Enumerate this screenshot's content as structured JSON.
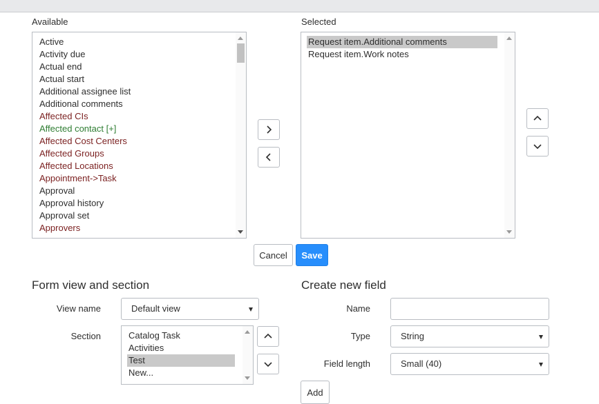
{
  "slushbucket": {
    "available_label": "Available",
    "selected_label": "Selected",
    "available_items": [
      {
        "label": "Active",
        "kind": "normal"
      },
      {
        "label": "Activity due",
        "kind": "normal"
      },
      {
        "label": "Actual end",
        "kind": "normal"
      },
      {
        "label": "Actual start",
        "kind": "normal"
      },
      {
        "label": "Additional assignee list",
        "kind": "normal"
      },
      {
        "label": "Additional comments",
        "kind": "normal"
      },
      {
        "label": "Affected CIs",
        "kind": "reference"
      },
      {
        "label": "Affected contact [+]",
        "kind": "green"
      },
      {
        "label": "Affected Cost Centers",
        "kind": "reference"
      },
      {
        "label": "Affected Groups",
        "kind": "reference"
      },
      {
        "label": "Affected Locations",
        "kind": "reference"
      },
      {
        "label": "Appointment->Task",
        "kind": "reference"
      },
      {
        "label": "Approval",
        "kind": "normal"
      },
      {
        "label": "Approval history",
        "kind": "normal"
      },
      {
        "label": "Approval set",
        "kind": "normal"
      },
      {
        "label": "Approvers",
        "kind": "reference"
      }
    ],
    "selected_items": [
      {
        "label": "Request item.Additional comments",
        "selected": true
      },
      {
        "label": "Request item.Work notes",
        "selected": false
      }
    ]
  },
  "actions": {
    "cancel_label": "Cancel",
    "save_label": "Save"
  },
  "form_view": {
    "heading": "Form view and section",
    "view_name_label": "View name",
    "view_name_value": "Default view",
    "section_label": "Section",
    "sections": [
      {
        "label": "Catalog Task",
        "selected": false
      },
      {
        "label": "Activities",
        "selected": false
      },
      {
        "label": "Test",
        "selected": true
      },
      {
        "label": "New...",
        "selected": false
      }
    ]
  },
  "new_field": {
    "heading": "Create new field",
    "name_label": "Name",
    "name_value": "",
    "type_label": "Type",
    "type_value": "String",
    "length_label": "Field length",
    "length_value": "Small (40)",
    "add_label": "Add"
  },
  "colors": {
    "primary": "#278efc",
    "reference_text": "#7a1f1f",
    "extension_text": "#2e7d32",
    "selection_bg": "#c9c9c9"
  }
}
